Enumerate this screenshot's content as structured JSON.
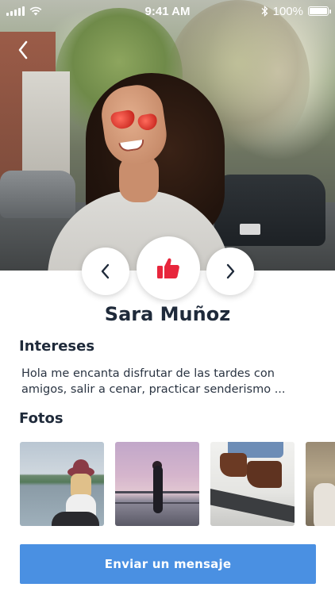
{
  "status_bar": {
    "time": "9:41 AM",
    "battery": "100%",
    "icons": [
      "signal-icon",
      "wifi-icon",
      "bluetooth-icon",
      "battery-icon"
    ]
  },
  "navigation": {
    "back_icon": "chevron-left-icon"
  },
  "actions": {
    "prev_icon": "chevron-left-icon",
    "like_icon": "thumbs-up-icon",
    "next_icon": "chevron-right-icon",
    "like_color": "#e8263c"
  },
  "profile": {
    "name": "Sara Muñoz"
  },
  "interests": {
    "title": "Intereses",
    "bio": "Hola me encanta disfrutar de las tardes con amigos, salir a cenar,  practicar senderismo ..."
  },
  "photos": {
    "title": "Fotos",
    "count_visible": 4
  },
  "message_button": {
    "label": "Enviar un mensaje",
    "color": "#4a90e2"
  }
}
